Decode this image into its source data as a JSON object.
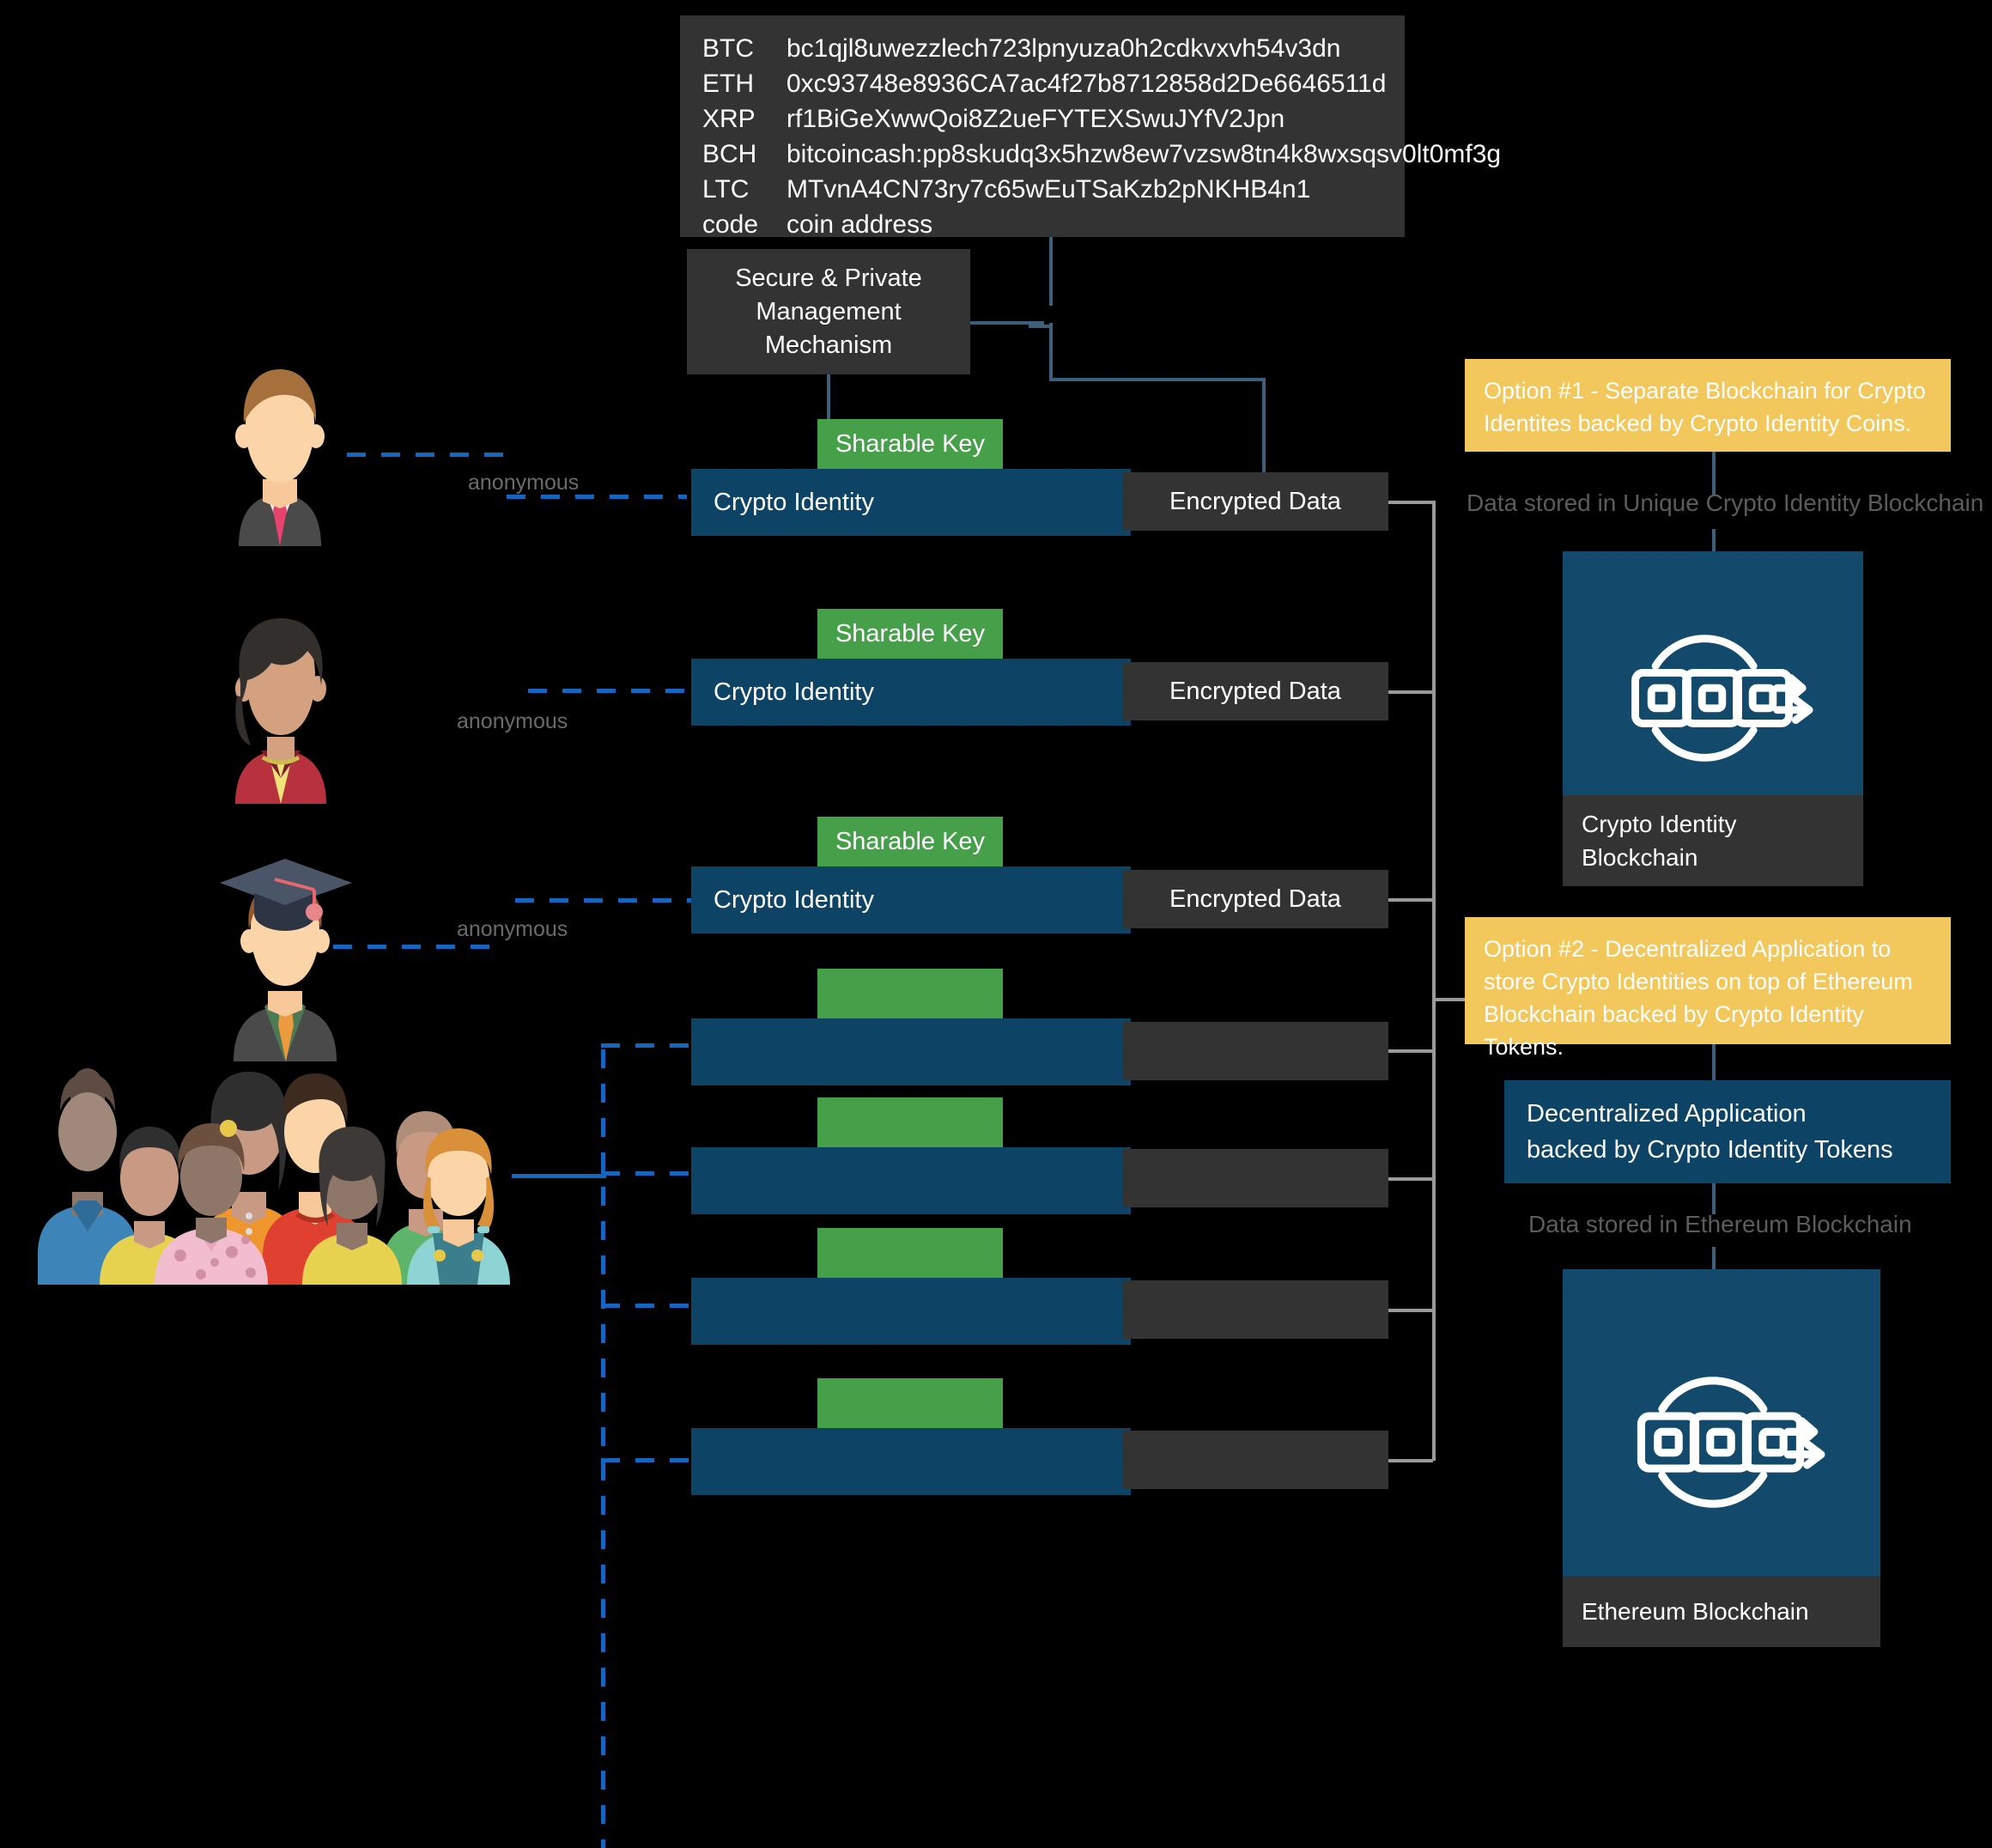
{
  "addresses": {
    "rows": [
      {
        "code": "BTC",
        "address": "bc1qjl8uwezzlech723lpnyuza0h2cdkvxvh54v3dn"
      },
      {
        "code": "ETH",
        "address": "0xc93748e8936CA7ac4f27b8712858d2De6646511d"
      },
      {
        "code": "XRP",
        "address": "rf1BiGeXwwQoi8Z2ueFYTEXSwuJYfV2Jpn"
      },
      {
        "code": "BCH",
        "address": "bitcoincash:pp8skudq3x5hzw8ew7vzsw8tn4k8wxsqsv0lt0mf3g"
      },
      {
        "code": "LTC",
        "address": "MTvnA4CN73ry7c65wEuTSaKzb2pNKHB4n1"
      },
      {
        "code": "code",
        "address": "coin address"
      }
    ]
  },
  "mechanism": {
    "line1": "Secure & Private",
    "line2": "Management",
    "line3": "Mechanism"
  },
  "actors": [
    {
      "name": "businessman",
      "anonymous_label": "anonymous"
    },
    {
      "name": "businesswoman",
      "anonymous_label": "anonymous"
    },
    {
      "name": "graduate",
      "anonymous_label": "anonymous"
    },
    {
      "name": "crowd",
      "anonymous_label": ""
    }
  ],
  "rows": [
    {
      "key_label": "Sharable Key",
      "identity_label": "Crypto Identity",
      "data_label": "Encrypted Data"
    },
    {
      "key_label": "Sharable Key",
      "identity_label": "Crypto Identity",
      "data_label": "Encrypted  Data"
    },
    {
      "key_label": "Sharable Key",
      "identity_label": "Crypto Identity",
      "data_label": "Encrypted  Data"
    },
    {
      "key_label": "",
      "identity_label": "",
      "data_label": ""
    },
    {
      "key_label": "",
      "identity_label": "",
      "data_label": ""
    },
    {
      "key_label": "",
      "identity_label": "",
      "data_label": ""
    },
    {
      "key_label": "",
      "identity_label": "",
      "data_label": ""
    }
  ],
  "option1": {
    "callout": "Option #1 - Separate Blockchain for Crypto Identites backed by Crypto Identity Coins.",
    "storage_note": "Data stored in Unique Crypto Identity Blockchain",
    "card_caption_line1": "Crypto Identity",
    "card_caption_line2": "Blockchain",
    "icon": "blockchain-icon"
  },
  "option2": {
    "callout": "Option #2 - Decentralized Application to store Crypto Identities on top of Ethereum Blockchain backed by Crypto Identity Tokens.",
    "dapp_line1": "Decentralized Application",
    "dapp_line2": "backed by Crypto Identity Tokens",
    "storage_note": "Data stored in Ethereum Blockchain",
    "card_caption": "Ethereum Blockchain",
    "icon": "blockchain-icon"
  },
  "colors": {
    "background": "#000000",
    "dark_box": "#333333",
    "blue_box": "#0d4466",
    "green_box": "#45a049",
    "yellow_callout": "#f2c75c",
    "card_blue": "#134a6b",
    "connector_blue": "#13559f",
    "connector_steel": "#3d5f7c",
    "connector_gray": "#9a9a9a",
    "muted_text": "#5c5c5c"
  }
}
